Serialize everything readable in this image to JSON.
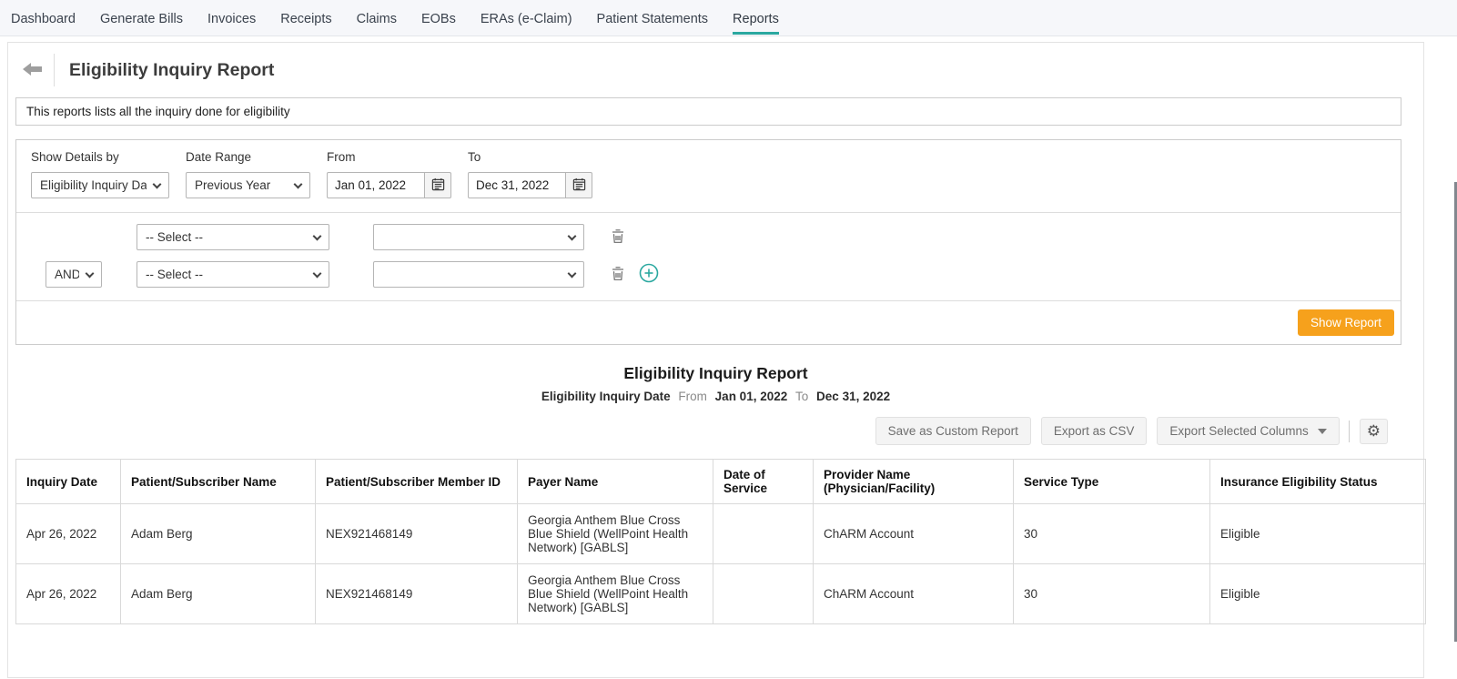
{
  "nav": {
    "items": [
      {
        "label": "Dashboard"
      },
      {
        "label": "Generate Bills"
      },
      {
        "label": "Invoices"
      },
      {
        "label": "Receipts"
      },
      {
        "label": "Claims"
      },
      {
        "label": "EOBs"
      },
      {
        "label": "ERAs (e-Claim)"
      },
      {
        "label": "Patient Statements"
      },
      {
        "label": "Reports"
      }
    ],
    "active": "Reports"
  },
  "header": {
    "title": "Eligibility Inquiry Report"
  },
  "description": "This reports lists all the inquiry done for eligibility",
  "filters": {
    "show_details_by": {
      "label": "Show Details by",
      "value": "Eligibility Inquiry Da"
    },
    "date_range": {
      "label": "Date Range",
      "value": "Previous Year"
    },
    "from": {
      "label": "From",
      "value": "Jan 01, 2022"
    },
    "to": {
      "label": "To",
      "value": "Dec 31, 2022"
    },
    "condition_rows": [
      {
        "field": "-- Select --",
        "value": ""
      },
      {
        "operator": "AND",
        "field": "-- Select --",
        "value": ""
      }
    ],
    "show_report_label": "Show Report"
  },
  "report": {
    "title": "Eligibility Inquiry Report",
    "subtitle": {
      "field": "Eligibility Inquiry Date",
      "from_label": "From",
      "from_value": "Jan 01, 2022",
      "to_label": "To",
      "to_value": "Dec 31, 2022"
    },
    "actions": {
      "save_custom": "Save as Custom Report",
      "export_csv": "Export as CSV",
      "export_selected": "Export Selected Columns"
    }
  },
  "table": {
    "columns": [
      "Inquiry Date",
      "Patient/Subscriber Name",
      "Patient/Subscriber Member ID",
      "Payer Name",
      "Date of Service",
      "Provider Name (Physician/Facility)",
      "Service Type",
      "Insurance Eligibility Status"
    ],
    "rows": [
      [
        "Apr 26, 2022",
        "Adam Berg",
        "NEX921468149",
        "Georgia Anthem Blue Cross Blue Shield (WellPoint Health Network) [GABLS]",
        "",
        "ChARM Account",
        "30",
        "Eligible"
      ],
      [
        "Apr 26, 2022",
        "Adam Berg",
        "NEX921468149",
        "Georgia Anthem Blue Cross Blue Shield (WellPoint Health Network) [GABLS]",
        "",
        "ChARM Account",
        "30",
        "Eligible"
      ]
    ]
  },
  "icons": {
    "back": "arrow-left",
    "calendar": "calendar",
    "delete": "trash",
    "add": "plus-circle",
    "settings": "gear",
    "select_caret": "chevron-down"
  },
  "colors": {
    "accent_teal": "#2BA8A0",
    "accent_orange": "#F6A11C"
  }
}
